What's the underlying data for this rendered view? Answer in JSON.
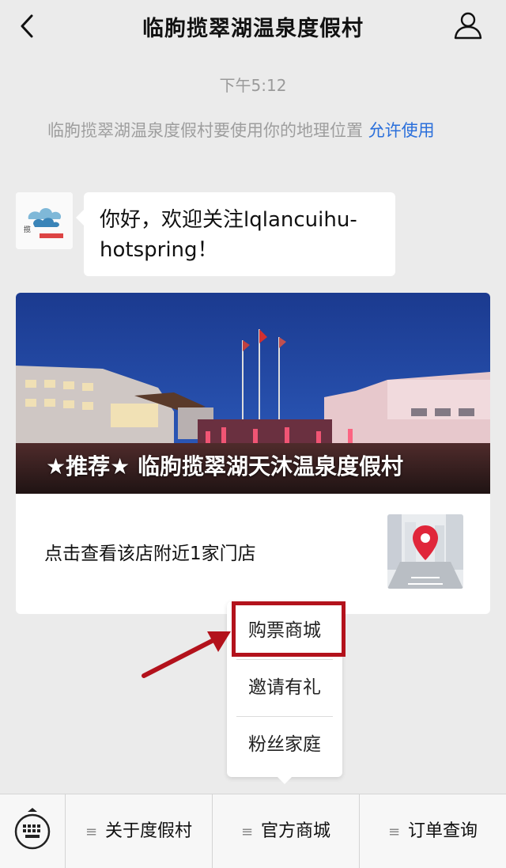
{
  "header": {
    "title": "临朐揽翠湖温泉度假村",
    "back_icon": "chevron-left-icon",
    "profile_icon": "person-icon"
  },
  "chat": {
    "time": "下午5:12",
    "notice": {
      "text": "临朐揽翠湖温泉度假村要使用你的地理位置 ",
      "allow_label": "允许使用",
      "allow_color": "#2a6fdb"
    },
    "greeting": "你好，欢迎关注lqlancuihu-hotspring！",
    "card": {
      "caption": "★推荐★ 临朐揽翠湖天沐温泉度假村",
      "text": "点击查看该店附近1家门店",
      "thumb_icon": "map-pin-icon"
    }
  },
  "popup": {
    "items": [
      "购票商城",
      "邀请有礼",
      "粉丝家庭"
    ],
    "highlight_color": "#b3121c"
  },
  "bottom_menu": {
    "keyboard_icon": "keyboard-icon",
    "items": [
      {
        "label": "关于度假村"
      },
      {
        "label": "官方商城"
      },
      {
        "label": "订单查询"
      }
    ]
  }
}
